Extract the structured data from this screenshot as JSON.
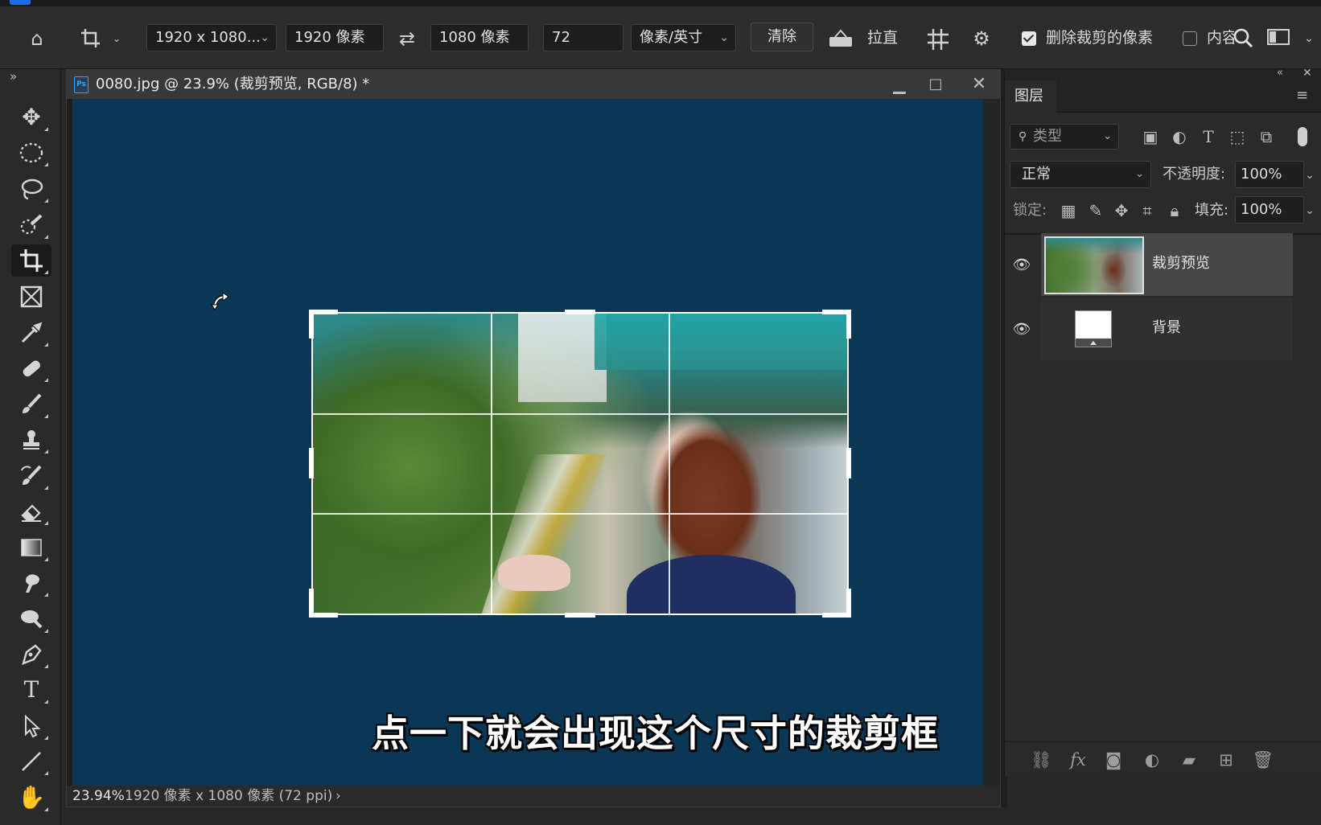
{
  "options_bar": {
    "ratio_preset": "1920 x 1080...",
    "width_value": "1920 像素",
    "height_value": "1080 像素",
    "resolution_value": "72",
    "resolution_unit": "像素/英寸",
    "clear_label": "清除",
    "straighten_label": "拉直",
    "delete_cropped_label": "删除裁剪的像素",
    "delete_cropped_checked": true,
    "content_aware_label": "内容",
    "content_aware_checked": false
  },
  "document": {
    "title": "0080.jpg @ 23.9% (裁剪预览, RGB/8) *",
    "zoom": "23.94%",
    "status_info": "1920 像素 x 1080 像素 (72 ppi)",
    "canvas_color": "#0a3755",
    "subtitle": "点一下就会出现这个尺寸的裁剪框"
  },
  "layers_panel": {
    "tab_label": "图层",
    "filter_placeholder": "类型",
    "blend_mode": "正常",
    "opacity_label": "不透明度:",
    "opacity_value": "100%",
    "lock_label": "锁定:",
    "fill_label": "填充:",
    "fill_value": "100%",
    "layers": [
      {
        "name": "裁剪预览",
        "visible": true,
        "selected": true
      },
      {
        "name": "背景",
        "visible": true,
        "selected": false
      }
    ]
  },
  "tools": [
    "move-tool",
    "elliptical-marquee-tool",
    "lasso-tool",
    "quick-selection-tool",
    "crop-tool",
    "frame-tool",
    "eyedropper-tool",
    "spot-healing-tool",
    "brush-tool",
    "clone-stamp-tool",
    "history-brush-tool",
    "eraser-tool",
    "gradient-tool",
    "smudge-tool",
    "dodge-tool",
    "pen-tool",
    "type-tool",
    "path-selection-tool",
    "line-tool",
    "hand-tool"
  ],
  "active_tool": "crop-tool",
  "colors": {
    "accent": "#31a8ff",
    "ui_bg": "#2a2a2a"
  }
}
